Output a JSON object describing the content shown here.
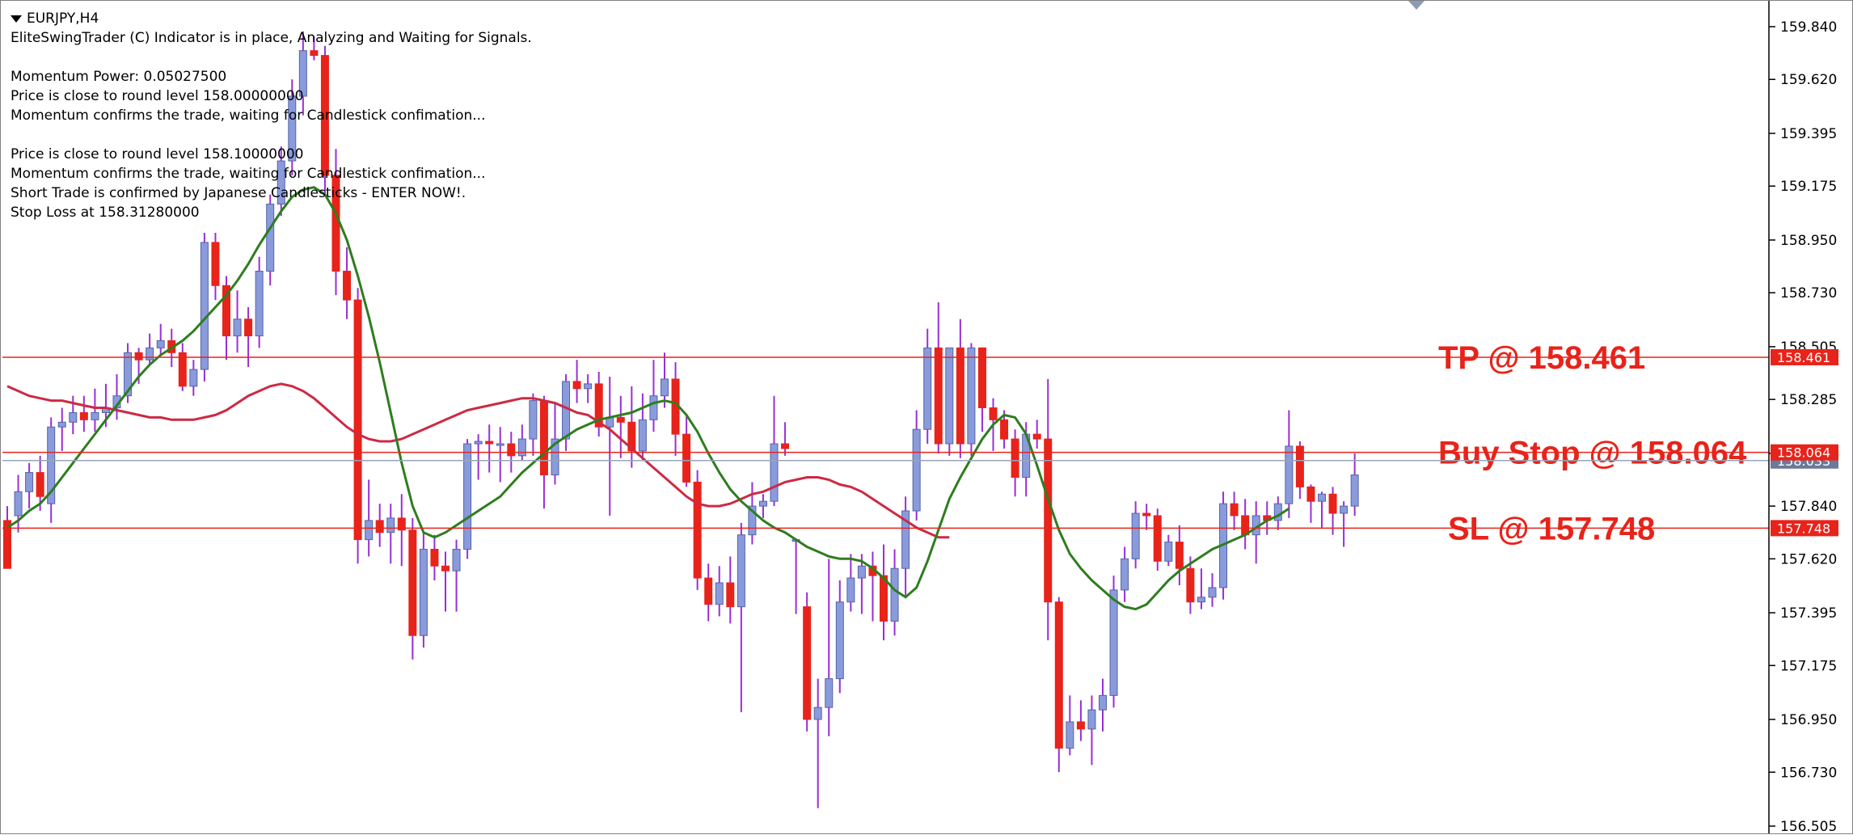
{
  "window": {
    "symbol_title": "EURJPY,H4"
  },
  "info_lines": [
    "EliteSwingTrader (C) Indicator is in place, Analyzing and Waiting for Signals.",
    "",
    "Momentum Power: 0.05027500",
    "Price is close to round level 158.00000000",
    "Momentum confirms the trade, waiting for Candlestick confimation...",
    "",
    "Price is close to round level 158.10000000",
    "Momentum confirms the trade, waiting for Candlestick confimation...",
    "Short Trade is confirmed by Japanese Candlesticks - ENTER NOW!.",
    "Stop Loss at 158.31280000"
  ],
  "colors": {
    "bull_candle": "#8a9bdc",
    "bear_candle": "#e8231a",
    "wick_color": "#9a2ed6",
    "fast_ma": "#2e7d1f",
    "slow_ma": "#cc2a44",
    "level_line": "#e8231a",
    "annotation": "#e8231a",
    "axis_text": "#000000"
  },
  "chart_data": {
    "type": "candlestick",
    "symbol": "EURJPY",
    "timeframe": "H4",
    "ylim": [
      156.505,
      159.84
    ],
    "y_ticks": [
      "159.840",
      "159.620",
      "159.395",
      "159.175",
      "158.950",
      "158.730",
      "158.505",
      "158.285",
      "158.060",
      "157.840",
      "157.620",
      "157.395",
      "157.175",
      "156.950",
      "156.730",
      "156.505"
    ],
    "y_tick_values": [
      159.84,
      159.62,
      159.395,
      159.175,
      158.95,
      158.73,
      158.505,
      158.285,
      158.06,
      157.84,
      157.62,
      157.395,
      157.175,
      156.95,
      156.73,
      156.505
    ],
    "candles": [
      [
        157.78,
        157.58,
        157.84,
        157.58
      ],
      [
        157.8,
        157.9,
        157.97,
        157.73
      ],
      [
        157.9,
        157.98,
        158.02,
        157.83
      ],
      [
        157.98,
        157.88,
        158.05,
        157.82
      ],
      [
        157.85,
        158.17,
        158.21,
        157.77
      ],
      [
        158.17,
        158.19,
        158.25,
        158.07
      ],
      [
        158.19,
        158.23,
        158.3,
        158.14
      ],
      [
        158.23,
        158.2,
        158.3,
        158.15
      ],
      [
        158.2,
        158.23,
        158.33,
        158.15
      ],
      [
        158.23,
        158.25,
        158.35,
        158.17
      ],
      [
        158.25,
        158.3,
        158.39,
        158.2
      ],
      [
        158.3,
        158.48,
        158.52,
        158.27
      ],
      [
        158.48,
        158.45,
        158.5,
        158.35
      ],
      [
        158.45,
        158.5,
        158.56,
        158.43
      ],
      [
        158.5,
        158.53,
        158.6,
        158.47
      ],
      [
        158.53,
        158.48,
        158.58,
        158.42
      ],
      [
        158.48,
        158.34,
        158.52,
        158.32
      ],
      [
        158.34,
        158.41,
        158.45,
        158.3
      ],
      [
        158.41,
        158.94,
        158.98,
        158.36
      ],
      [
        158.94,
        158.76,
        158.98,
        158.7
      ],
      [
        158.76,
        158.55,
        158.8,
        158.45
      ],
      [
        158.55,
        158.62,
        158.74,
        158.48
      ],
      [
        158.62,
        158.55,
        158.67,
        158.42
      ],
      [
        158.55,
        158.82,
        158.88,
        158.5
      ],
      [
        158.82,
        159.1,
        159.14,
        158.76
      ],
      [
        159.1,
        159.28,
        159.34,
        159.05
      ],
      [
        159.28,
        159.55,
        159.62,
        159.22
      ],
      [
        159.55,
        159.74,
        159.82,
        159.47
      ],
      [
        159.74,
        159.72,
        159.8,
        159.7
      ],
      [
        159.72,
        159.22,
        159.76,
        159.14
      ],
      [
        159.22,
        158.82,
        159.33,
        158.72
      ],
      [
        158.82,
        158.7,
        158.92,
        158.62
      ],
      [
        158.7,
        157.7,
        158.75,
        157.6
      ],
      [
        157.7,
        157.78,
        157.95,
        157.63
      ],
      [
        157.78,
        157.73,
        157.85,
        157.67
      ],
      [
        157.73,
        157.79,
        157.85,
        157.6
      ],
      [
        157.79,
        157.74,
        157.89,
        157.59
      ],
      [
        157.74,
        157.3,
        157.79,
        157.2
      ],
      [
        157.3,
        157.66,
        157.73,
        157.25
      ],
      [
        157.66,
        157.59,
        157.72,
        157.53
      ],
      [
        157.59,
        157.57,
        157.65,
        157.4
      ],
      [
        157.57,
        157.66,
        157.7,
        157.4
      ],
      [
        157.66,
        158.1,
        158.12,
        157.62
      ],
      [
        158.1,
        158.11,
        158.14,
        157.95
      ],
      [
        158.11,
        158.1,
        158.18,
        157.98
      ],
      [
        158.1,
        158.1,
        158.17,
        157.94
      ],
      [
        158.1,
        158.05,
        158.15,
        157.98
      ],
      [
        158.05,
        158.12,
        158.18,
        158.03
      ],
      [
        158.12,
        158.28,
        158.31,
        158.05
      ],
      [
        158.28,
        157.97,
        158.3,
        157.83
      ],
      [
        157.97,
        158.12,
        158.27,
        157.93
      ],
      [
        158.12,
        158.36,
        158.39,
        158.07
      ],
      [
        158.36,
        158.33,
        158.45,
        158.27
      ],
      [
        158.33,
        158.35,
        158.39,
        158.27
      ],
      [
        158.35,
        158.17,
        158.4,
        158.13
      ],
      [
        158.17,
        158.21,
        158.38,
        157.8
      ],
      [
        158.21,
        158.19,
        158.3,
        158.04
      ],
      [
        158.19,
        158.07,
        158.34,
        158.0
      ],
      [
        158.07,
        158.2,
        158.31,
        158.03
      ],
      [
        158.2,
        158.3,
        158.45,
        158.15
      ],
      [
        158.3,
        158.37,
        158.48,
        158.25
      ],
      [
        158.37,
        158.14,
        158.44,
        158.05
      ],
      [
        158.14,
        157.94,
        158.22,
        157.92
      ],
      [
        157.94,
        157.54,
        157.99,
        157.49
      ],
      [
        157.54,
        157.43,
        157.6,
        157.36
      ],
      [
        157.43,
        157.52,
        157.59,
        157.38
      ],
      [
        157.52,
        157.42,
        157.63,
        157.35
      ],
      [
        157.42,
        157.72,
        157.77,
        156.98
      ],
      [
        157.72,
        157.84,
        157.94,
        157.68
      ],
      [
        157.84,
        157.86,
        157.89,
        157.79
      ],
      [
        157.86,
        158.1,
        158.3,
        157.84
      ],
      [
        158.1,
        158.08,
        158.19,
        158.05
      ],
      [
        157.7,
        157.7,
        157.7,
        157.39
      ],
      [
        157.42,
        156.95,
        157.48,
        156.9
      ],
      [
        156.95,
        157.0,
        157.12,
        156.58
      ],
      [
        157.0,
        157.12,
        157.62,
        156.88
      ],
      [
        157.12,
        157.44,
        157.53,
        157.06
      ],
      [
        157.44,
        157.54,
        157.64,
        157.4
      ],
      [
        157.54,
        157.59,
        157.64,
        157.39
      ],
      [
        157.59,
        157.55,
        157.65,
        157.36
      ],
      [
        157.55,
        157.36,
        157.68,
        157.28
      ],
      [
        157.36,
        157.58,
        157.66,
        157.3
      ],
      [
        157.58,
        157.82,
        157.88,
        157.46
      ],
      [
        157.82,
        158.16,
        158.24,
        157.78
      ],
      [
        158.16,
        158.5,
        158.58,
        158.1
      ],
      [
        158.5,
        158.1,
        158.69,
        158.06
      ],
      [
        158.1,
        158.5,
        158.5,
        158.05
      ],
      [
        158.5,
        158.1,
        158.62,
        158.04
      ],
      [
        158.1,
        158.5,
        158.52,
        158.05
      ],
      [
        158.5,
        158.25,
        158.5,
        158.15
      ],
      [
        158.25,
        158.2,
        158.29,
        158.07
      ],
      [
        158.2,
        158.12,
        158.24,
        158.08
      ],
      [
        158.12,
        157.96,
        158.16,
        157.88
      ],
      [
        157.96,
        158.14,
        158.19,
        157.88
      ],
      [
        158.14,
        158.12,
        158.2,
        158.08
      ],
      [
        158.12,
        157.44,
        158.37,
        157.28
      ],
      [
        157.44,
        156.83,
        157.46,
        156.73
      ],
      [
        156.83,
        156.94,
        157.05,
        156.8
      ],
      [
        156.94,
        156.91,
        157.03,
        156.86
      ],
      [
        156.91,
        156.99,
        157.05,
        156.76
      ],
      [
        156.99,
        157.05,
        157.12,
        156.9
      ],
      [
        157.05,
        157.49,
        157.55,
        157.0
      ],
      [
        157.49,
        157.62,
        157.67,
        157.44
      ],
      [
        157.62,
        157.81,
        157.86,
        157.58
      ],
      [
        157.81,
        157.8,
        157.85,
        157.74
      ],
      [
        157.8,
        157.61,
        157.83,
        157.57
      ],
      [
        157.61,
        157.69,
        157.72,
        157.59
      ],
      [
        157.69,
        157.58,
        157.76,
        157.51
      ],
      [
        157.58,
        157.44,
        157.63,
        157.39
      ],
      [
        157.44,
        157.46,
        157.58,
        157.41
      ],
      [
        157.46,
        157.5,
        157.56,
        157.42
      ],
      [
        157.5,
        157.85,
        157.9,
        157.45
      ],
      [
        157.85,
        157.8,
        157.9,
        157.74
      ],
      [
        157.8,
        157.72,
        157.87,
        157.66
      ],
      [
        157.72,
        157.8,
        157.86,
        157.6
      ],
      [
        157.8,
        157.78,
        157.86,
        157.72
      ],
      [
        157.78,
        157.85,
        157.88,
        157.74
      ],
      [
        157.85,
        158.09,
        158.24,
        157.79
      ],
      [
        158.09,
        157.92,
        158.11,
        157.87
      ],
      [
        157.92,
        157.86,
        157.93,
        157.77
      ],
      [
        157.86,
        157.89,
        157.9,
        157.75
      ],
      [
        157.89,
        157.81,
        157.92,
        157.72
      ],
      [
        157.81,
        157.84,
        157.86,
        157.67
      ],
      [
        157.84,
        157.97,
        158.06,
        157.8
      ]
    ],
    "fast_ma": [
      157.75,
      157.78,
      157.82,
      157.85,
      157.9,
      157.96,
      158.02,
      158.08,
      158.14,
      158.2,
      158.26,
      158.32,
      158.38,
      158.43,
      158.47,
      158.5,
      158.53,
      158.57,
      158.62,
      158.67,
      158.72,
      158.78,
      158.85,
      158.93,
      159.0,
      159.07,
      159.13,
      159.16,
      159.17,
      159.14,
      159.06,
      158.95,
      158.8,
      158.63,
      158.44,
      158.23,
      158.02,
      157.84,
      157.73,
      157.71,
      157.73,
      157.76,
      157.79,
      157.82,
      157.85,
      157.88,
      157.93,
      157.98,
      158.02,
      158.06,
      158.1,
      158.13,
      158.16,
      158.18,
      158.2,
      158.21,
      158.22,
      158.23,
      158.25,
      158.27,
      158.28,
      158.27,
      158.22,
      158.15,
      158.06,
      157.98,
      157.91,
      157.86,
      157.82,
      157.78,
      157.75,
      157.73,
      157.7,
      157.67,
      157.65,
      157.63,
      157.62,
      157.62,
      157.61,
      157.58,
      157.54,
      157.49,
      157.46,
      157.5,
      157.61,
      157.74,
      157.87,
      157.96,
      158.04,
      158.12,
      158.18,
      158.22,
      158.21,
      158.14,
      158.01,
      157.87,
      157.74,
      157.64,
      157.58,
      157.53,
      157.49,
      157.45,
      157.42,
      157.41,
      157.43,
      157.48,
      157.53,
      157.57,
      157.6,
      157.63,
      157.66,
      157.68,
      157.7,
      157.72,
      157.75,
      157.78,
      157.8,
      157.83
    ],
    "slow_ma": [
      158.34,
      158.32,
      158.3,
      158.29,
      158.28,
      158.28,
      158.27,
      158.26,
      158.25,
      158.25,
      158.24,
      158.23,
      158.22,
      158.21,
      158.21,
      158.2,
      158.2,
      158.2,
      158.21,
      158.22,
      158.24,
      158.27,
      158.3,
      158.32,
      158.34,
      158.35,
      158.34,
      158.32,
      158.29,
      158.25,
      158.21,
      158.17,
      158.14,
      158.12,
      158.11,
      158.11,
      158.12,
      158.14,
      158.16,
      158.18,
      158.2,
      158.22,
      158.24,
      158.25,
      158.26,
      158.27,
      158.28,
      158.29,
      158.29,
      158.28,
      158.27,
      158.25,
      158.23,
      158.22,
      158.19,
      158.16,
      158.12,
      158.08,
      158.04,
      158.0,
      157.96,
      157.92,
      157.88,
      157.85,
      157.84,
      157.84,
      157.85,
      157.87,
      157.89,
      157.9,
      157.92,
      157.94,
      157.95,
      157.96,
      157.96,
      157.95,
      157.93,
      157.92,
      157.9,
      157.87,
      157.84,
      157.81,
      157.78,
      157.75,
      157.73,
      157.71,
      157.71
    ],
    "levels": [
      {
        "label": "TP",
        "value": 158.461,
        "tag": "158.461",
        "annotation": "TP @ 158.461"
      },
      {
        "label": "Buy Stop",
        "value": 158.064,
        "tag": "158.064",
        "annotation": "Buy Stop @ 158.064"
      },
      {
        "label": "SL",
        "value": 157.748,
        "tag": "157.748",
        "annotation": "SL @ 157.748"
      }
    ],
    "current_bid": 158.03,
    "current_bid_tag": "158.033",
    "grid": false
  }
}
